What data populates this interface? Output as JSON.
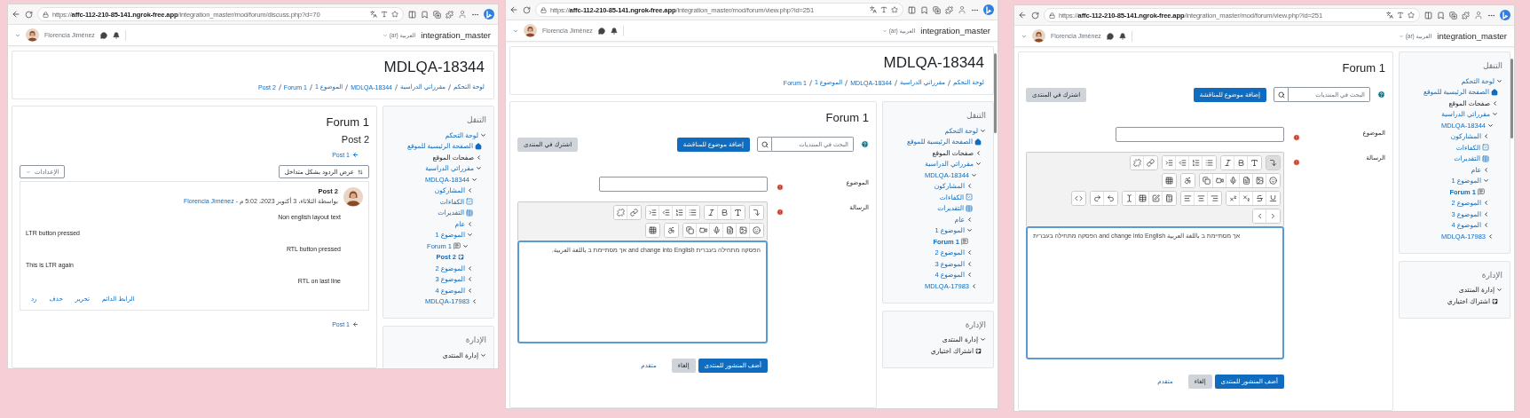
{
  "left_window": {
    "kind": "discussion",
    "url": "https://**affc-112-210-85-141.ngrok-free.app**/integration_master/mod/forum/discuss.php?d=70",
    "navbar": {
      "user": "Florencia Jiménez",
      "language": "العربية (ar)",
      "site": "integration_master"
    },
    "header": {
      "title": "MDLQA-18344",
      "breadcrumb": [
        "لوحة التحكم",
        "مقرراتي الدراسية",
        "MDLQA-18344",
        "الموضوع 1",
        "Forum 1",
        "Post 2"
      ]
    },
    "main": {
      "title": "Forum 1",
      "subtitle": "Post 2",
      "nav_link_top": "Post 1",
      "display_mode": "عرض الردود بشكل متداخل",
      "settings": "الإعدادات",
      "post": {
        "subject": "Post 2",
        "byline": "بواسطة الثلاثاء، 3 أكتوبر 2023، 5:02 م - ",
        "author": "Florencia Jiménez",
        "paragraphs": [
          {
            "text": "Non english layout text",
            "rtl": true
          },
          {
            "text": "LTR button pressed",
            "rtl": false
          },
          {
            "text": "RTL button pressed",
            "rtl": true
          },
          {
            "text": "This is LTR again",
            "rtl": false
          },
          {
            "text": "RTL on last line",
            "rtl": true
          }
        ],
        "actions": [
          "الرابط الدائم",
          "تحرير",
          "حذف",
          "رد"
        ]
      },
      "nav_link_bottom": "Post 1"
    },
    "sidebar": {
      "navigation": {
        "title": "التنقل",
        "items": [
          {
            "label": "لوحة التحكم",
            "link": true,
            "expanded": true,
            "selected": false,
            "children": [
              {
                "label": "الصفحة الرئيسية للموقع",
                "link": true,
                "kind": "home",
                "selected": false
              },
              {
                "label": "صفحات الموقع",
                "link": false,
                "expanded": false,
                "selected": false
              },
              {
                "label": "مقرراتي الدراسية",
                "link": true,
                "expanded": true,
                "selected": false,
                "children": [
                  {
                    "label": "MDLQA-18344",
                    "link": true,
                    "expanded": true,
                    "selected": false,
                    "children": [
                      {
                        "label": "المشاركون",
                        "link": true,
                        "expanded": false,
                        "selected": false
                      },
                      {
                        "label": "الكفاءات",
                        "link": true,
                        "kind": "competencies",
                        "selected": false
                      },
                      {
                        "label": "التقديرات",
                        "link": true,
                        "kind": "grades",
                        "selected": false
                      },
                      {
                        "label": "عام",
                        "link": true,
                        "expanded": false,
                        "selected": false
                      },
                      {
                        "label": "الموضوع 1",
                        "link": true,
                        "expanded": true,
                        "selected": false,
                        "children": [
                          {
                            "label": "Forum 1",
                            "link": true,
                            "kind": "forum",
                            "expanded": true,
                            "selected": false,
                            "children": [
                              {
                                "label": "Post 2",
                                "link": true,
                                "kind": "post",
                                "selected": true
                              }
                            ]
                          }
                        ]
                      },
                      {
                        "label": "الموضوع 2",
                        "link": true,
                        "expanded": false,
                        "selected": false
                      },
                      {
                        "label": "الموضوع 3",
                        "link": true,
                        "expanded": false,
                        "selected": false
                      },
                      {
                        "label": "الموضوع 4",
                        "link": true,
                        "expanded": false,
                        "selected": false
                      }
                    ]
                  },
                  {
                    "label": "MDLQA-17983",
                    "link": true,
                    "expanded": false,
                    "selected": false
                  }
                ]
              }
            ]
          }
        ]
      },
      "admin": {
        "title": "الإدارة",
        "items": [
          {
            "label": "إدارة المنتدى",
            "link": false,
            "expanded": true,
            "selected": false
          }
        ]
      }
    }
  },
  "middle_window": {
    "kind": "forum_view",
    "url": "https://**affc-112-210-85-141.ngrok-free.app**/integration_master/mod/forum/view.php?id=251",
    "navbar": {
      "user": "Florencia Jiménez",
      "language": "العربية (ar)",
      "site": "integration_master"
    },
    "header": {
      "title": "MDLQA-18344",
      "breadcrumb": [
        "لوحة التحكم",
        "مقرراتي الدراسية",
        "MDLQA-18344",
        "الموضوع 1",
        "Forum 1"
      ]
    },
    "main": {
      "title": "Forum 1",
      "search_placeholder": "البحث في المنتديات",
      "add_button": "إضافة موضوع للمناقشة",
      "subscribe_button": "اشترك في المنتدى",
      "form": {
        "subject_label": "الموضوع",
        "message_label": "الرسالة",
        "toolbar_expanded": false,
        "message": {
          "text": "הפסקה מתחילה בעברית and change into English אך מסתיימת ב باللغة العربية.",
          "rtl": true
        },
        "submit": "أضف المنشور للمنتدى",
        "cancel": "إلغاء",
        "advanced": "متقدم"
      }
    },
    "sidebar": {
      "navigation": {
        "title": "التنقل",
        "items": [
          {
            "label": "لوحة التحكم",
            "link": true,
            "expanded": true,
            "selected": false,
            "children": [
              {
                "label": "الصفحة الرئيسية للموقع",
                "link": true,
                "kind": "home",
                "selected": false
              },
              {
                "label": "صفحات الموقع",
                "link": false,
                "expanded": false,
                "selected": false
              },
              {
                "label": "مقرراتي الدراسية",
                "link": true,
                "expanded": true,
                "selected": false,
                "children": [
                  {
                    "label": "MDLQA-18344",
                    "link": true,
                    "expanded": true,
                    "selected": false,
                    "children": [
                      {
                        "label": "المشاركون",
                        "link": true,
                        "expanded": false,
                        "selected": false
                      },
                      {
                        "label": "الكفاءات",
                        "link": true,
                        "kind": "competencies",
                        "selected": false
                      },
                      {
                        "label": "التقديرات",
                        "link": true,
                        "kind": "grades",
                        "selected": false
                      },
                      {
                        "label": "عام",
                        "link": true,
                        "expanded": false,
                        "selected": false
                      },
                      {
                        "label": "الموضوع 1",
                        "link": true,
                        "expanded": true,
                        "selected": false,
                        "children": [
                          {
                            "label": "Forum 1",
                            "link": true,
                            "kind": "forum",
                            "selected": true
                          }
                        ]
                      },
                      {
                        "label": "الموضوع 2",
                        "link": true,
                        "expanded": false,
                        "selected": false
                      },
                      {
                        "label": "الموضوع 3",
                        "link": true,
                        "expanded": false,
                        "selected": false
                      },
                      {
                        "label": "الموضوع 4",
                        "link": true,
                        "expanded": false,
                        "selected": false
                      }
                    ]
                  },
                  {
                    "label": "MDLQA-17983",
                    "link": true,
                    "expanded": false,
                    "selected": false
                  }
                ]
              }
            ]
          }
        ]
      },
      "admin": {
        "title": "الإدارة",
        "items": [
          {
            "label": "إدارة المنتدى",
            "link": false,
            "expanded": true,
            "selected": false,
            "children": [
              {
                "label": "اشتراك اختياري",
                "link": false,
                "kind": "setting",
                "selected": false
              }
            ]
          }
        ]
      }
    }
  },
  "right_window": {
    "kind": "forum_view",
    "url": "https://**affc-112-210-85-141.ngrok-free.app**/integration_master/mod/forum/view.php?id=251",
    "navbar": {
      "user": "Florencia Jiménez",
      "language": "العربية (ar)",
      "site": "integration_master"
    },
    "main": {
      "title": "Forum 1",
      "search_placeholder": "البحث في المنتديات",
      "add_button": "إضافة موضوع للمناقشة",
      "subscribe_button": "اشترك في المنتدى",
      "form": {
        "subject_label": "الموضوع",
        "message_label": "الرسالة",
        "toolbar_expanded": true,
        "message": {
          "text": "הפסקה מתחילה בעברית and change into English אך מסתיימת ב باللغة العربية",
          "rtl": false
        },
        "submit": "أضف المنشور للمنتدى",
        "cancel": "إلغاء",
        "advanced": "متقدم"
      }
    },
    "sidebar": {
      "navigation": {
        "title": "التنقل",
        "items": [
          {
            "label": "لوحة التحكم",
            "link": true,
            "expanded": true,
            "selected": false,
            "children": [
              {
                "label": "الصفحة الرئيسية للموقع",
                "link": true,
                "kind": "home",
                "selected": false
              },
              {
                "label": "صفحات الموقع",
                "link": false,
                "expanded": false,
                "selected": false
              },
              {
                "label": "مقرراتي الدراسية",
                "link": true,
                "expanded": true,
                "selected": false,
                "children": [
                  {
                    "label": "MDLQA-18344",
                    "link": true,
                    "expanded": true,
                    "selected": false,
                    "children": [
                      {
                        "label": "المشاركون",
                        "link": true,
                        "expanded": false,
                        "selected": false
                      },
                      {
                        "label": "الكفاءات",
                        "link": true,
                        "kind": "competencies",
                        "selected": false
                      },
                      {
                        "label": "التقديرات",
                        "link": true,
                        "kind": "grades",
                        "selected": false
                      },
                      {
                        "label": "عام",
                        "link": true,
                        "expanded": false,
                        "selected": false
                      },
                      {
                        "label": "الموضوع 1",
                        "link": true,
                        "expanded": true,
                        "selected": false,
                        "children": [
                          {
                            "label": "Forum 1",
                            "link": true,
                            "kind": "forum",
                            "selected": true
                          }
                        ]
                      },
                      {
                        "label": "الموضوع 2",
                        "link": true,
                        "expanded": false,
                        "selected": false
                      },
                      {
                        "label": "الموضوع 3",
                        "link": true,
                        "expanded": false,
                        "selected": false
                      },
                      {
                        "label": "الموضوع 4",
                        "link": true,
                        "expanded": false,
                        "selected": false
                      }
                    ]
                  },
                  {
                    "label": "MDLQA-17983",
                    "link": true,
                    "expanded": false,
                    "selected": false
                  }
                ]
              }
            ]
          }
        ]
      },
      "admin": {
        "title": "الإدارة",
        "items": [
          {
            "label": "إدارة المنتدى",
            "link": false,
            "expanded": true,
            "selected": false,
            "children": [
              {
                "label": "اشتراك اختياري",
                "link": false,
                "kind": "setting",
                "selected": false
              }
            ]
          }
        ]
      }
    }
  }
}
